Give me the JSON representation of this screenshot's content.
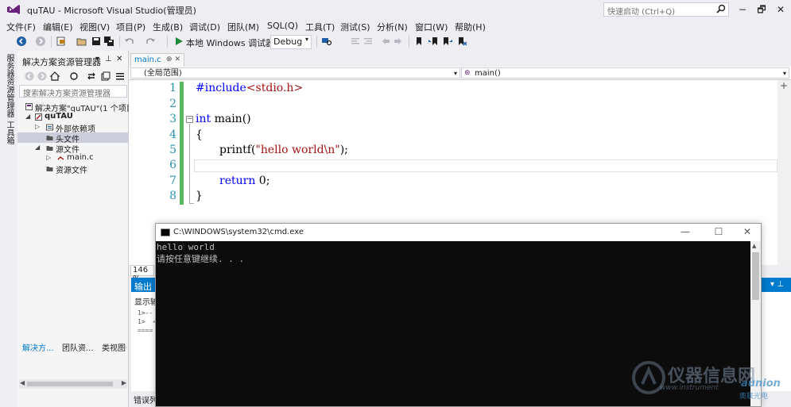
{
  "window": {
    "title": "quTAU - Microsoft Visual Studio(管理员)",
    "quick_launch_placeholder": "快速启动 (Ctrl+Q)",
    "controls": [
      "−",
      "🗗",
      "✕"
    ]
  },
  "menu": [
    "文件(F)",
    "编辑(E)",
    "视图(V)",
    "项目(P)",
    "生成(B)",
    "调试(D)",
    "团队(M)",
    "SQL(Q)",
    "工具(T)",
    "测试(S)",
    "分析(N)",
    "窗口(W)",
    "帮助(H)"
  ],
  "toolbar": {
    "run_label": "本地 Windows 调试器",
    "configuration": "Debug"
  },
  "left_strip": {
    "server_explorer": "服务器资源管理器",
    "toolbox": "工具箱"
  },
  "solution_explorer": {
    "title": "解决方案资源管理器",
    "search_placeholder": "搜索解决方案资源管理器",
    "tree": [
      {
        "label": "解决方案\"quTAU\"(1 个项目)",
        "level": 0,
        "arrow": ""
      },
      {
        "label": "quTAU",
        "level": 1,
        "arrow": "◢"
      },
      {
        "label": "外部依赖项",
        "level": 2,
        "arrow": "▷"
      },
      {
        "label": "头文件",
        "level": 2,
        "arrow": ""
      },
      {
        "label": "源文件",
        "level": 2,
        "arrow": "◢"
      },
      {
        "label": "main.c",
        "level": 3,
        "arrow": "▷"
      },
      {
        "label": "资源文件",
        "level": 2,
        "arrow": ""
      }
    ],
    "selected_index": 3
  },
  "bottom_tabs": [
    "解决方...",
    "团队资...",
    "类视图",
    "错误列"
  ],
  "editor": {
    "tab": "main.c",
    "scope": "(全局范围)",
    "member": "main()",
    "zoom": "146 %",
    "line_numbers": [
      "1",
      "2",
      "3",
      "4",
      "5",
      "6",
      "7",
      "8"
    ],
    "code": {
      "include_kw": "#include",
      "include_file": "<stdio.h>",
      "int_kw": "int",
      "main_sig": " main()",
      "open_brace": "{",
      "printf_fn": "printf(",
      "printf_str": "\"hello world\\n\"",
      "printf_end": ");",
      "return_kw": "return",
      "return_val": " 0;",
      "close_brace": "}"
    }
  },
  "output": {
    "title": "输出",
    "show_from": "显示输",
    "lines": [
      "1>--",
      "1>  <",
      "===="
    ]
  },
  "cmd": {
    "title": "C:\\WINDOWS\\system32\\cmd.exe",
    "lines": [
      "hello world",
      "请按任意键继续. . ."
    ]
  },
  "watermark": {
    "cn": "仪器信息网",
    "url": "www.instrument",
    "brand": "aunion",
    "brand_cn": "奥联光电"
  }
}
